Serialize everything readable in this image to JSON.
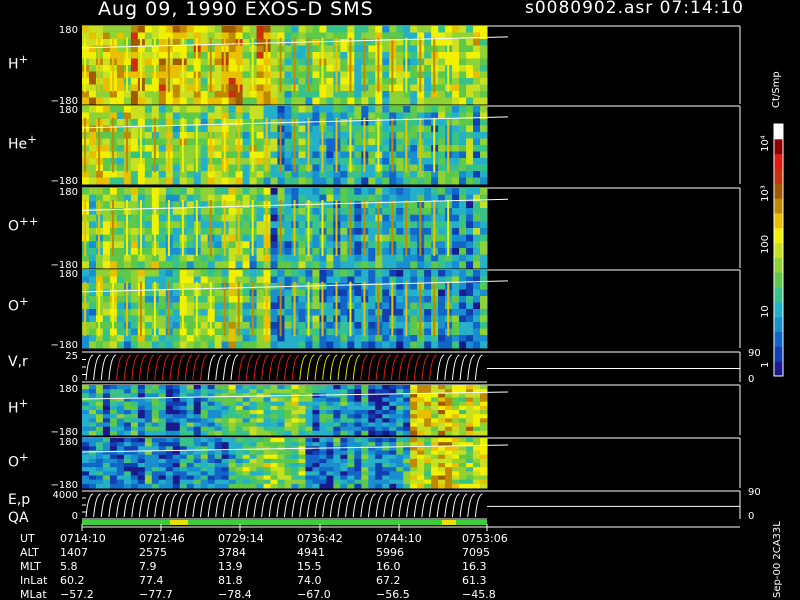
{
  "header": {
    "title": "Aug 09, 1990   EXOS-D SMS",
    "file_time": "s0080902.asr  07:14:10"
  },
  "colors": {
    "background": "#000000",
    "text": "#ffffff",
    "spectrogram_scale": [
      "#1a1a8c",
      "#0f3fb0",
      "#1266c8",
      "#1a8fd0",
      "#24b0c8",
      "#38c28a",
      "#5ec84a",
      "#8fd236",
      "#c8e020",
      "#f0f000",
      "#e8c000",
      "#c08a00",
      "#a05a00",
      "#c83010",
      "#e01a10",
      "#8a0000",
      "#ffffff"
    ]
  },
  "chart_data": [
    {
      "type": "heatmap",
      "name": "H+",
      "label": "H+",
      "ytick_top": "180",
      "ytick_bottom": "−180",
      "ylim": [
        -180,
        180
      ],
      "x_time": [
        "0714:10",
        "0753:06"
      ],
      "series_type": "spectrogram"
    },
    {
      "type": "heatmap",
      "name": "He+",
      "label": "He+",
      "ytick_top": "180",
      "ytick_bottom": "−180",
      "ylim": [
        -180,
        180
      ],
      "x_time": [
        "0714:10",
        "0753:06"
      ],
      "series_type": "spectrogram"
    },
    {
      "type": "heatmap",
      "name": "O++",
      "label": "O++",
      "ytick_top": "180",
      "ytick_bottom": "−180",
      "ylim": [
        -180,
        180
      ],
      "x_time": [
        "0714:10",
        "0753:06"
      ],
      "series_type": "spectrogram"
    },
    {
      "type": "heatmap",
      "name": "O+",
      "label": "O+",
      "ytick_top": "180",
      "ytick_bottom": "−180",
      "ylim": [
        -180,
        180
      ],
      "x_time": [
        "0714:10",
        "0753:06"
      ],
      "series_type": "spectrogram"
    },
    {
      "type": "line",
      "name": "V,r",
      "label": "V,r",
      "ytick_top": "25",
      "ytick_bottom": "0",
      "right_top": "90",
      "right_bottom": "0",
      "ylim": [
        0,
        25
      ]
    },
    {
      "type": "heatmap",
      "name": "H+ (low)",
      "label": "H+",
      "ytick_top": "180",
      "ytick_bottom": "−180",
      "ylim": [
        -180,
        180
      ],
      "series_type": "spectrogram"
    },
    {
      "type": "heatmap",
      "name": "O+ (low)",
      "label": "O+",
      "ytick_top": "180",
      "ytick_bottom": "−180",
      "ylim": [
        -180,
        180
      ],
      "series_type": "spectrogram"
    },
    {
      "type": "line",
      "name": "E,p",
      "label": "E,p",
      "ytick_top": "4000",
      "ytick_bottom": "0",
      "right_top": "90",
      "right_bottom": "0",
      "ylim": [
        0,
        4000
      ]
    }
  ],
  "qa": {
    "label": "QA"
  },
  "colorbar": {
    "unit": "Ct/Smp",
    "ticks": [
      "10⁴",
      "10³",
      "100",
      "10",
      "1"
    ]
  },
  "footer": {
    "rows": [
      {
        "label": "UT",
        "values": [
          "0714:10",
          "0721:46",
          "0729:14",
          "0736:42",
          "0744:10",
          "0753:06"
        ]
      },
      {
        "label": "ALT",
        "values": [
          "1407",
          "2575",
          "3784",
          "4941",
          "5996",
          "7095"
        ]
      },
      {
        "label": "MLT",
        "values": [
          "5.8",
          "7.9",
          "13.9",
          "15.5",
          "16.0",
          "16.3"
        ]
      },
      {
        "label": "InLat",
        "values": [
          "60.2",
          "77.4",
          "81.8",
          "74.0",
          "67.2",
          "61.3"
        ]
      },
      {
        "label": "MLat",
        "values": [
          "−57.2",
          "−77.7",
          "−78.4",
          "−67.0",
          "−56.5",
          "−45.8"
        ]
      }
    ],
    "version": "Sep-00 2CA33L"
  }
}
